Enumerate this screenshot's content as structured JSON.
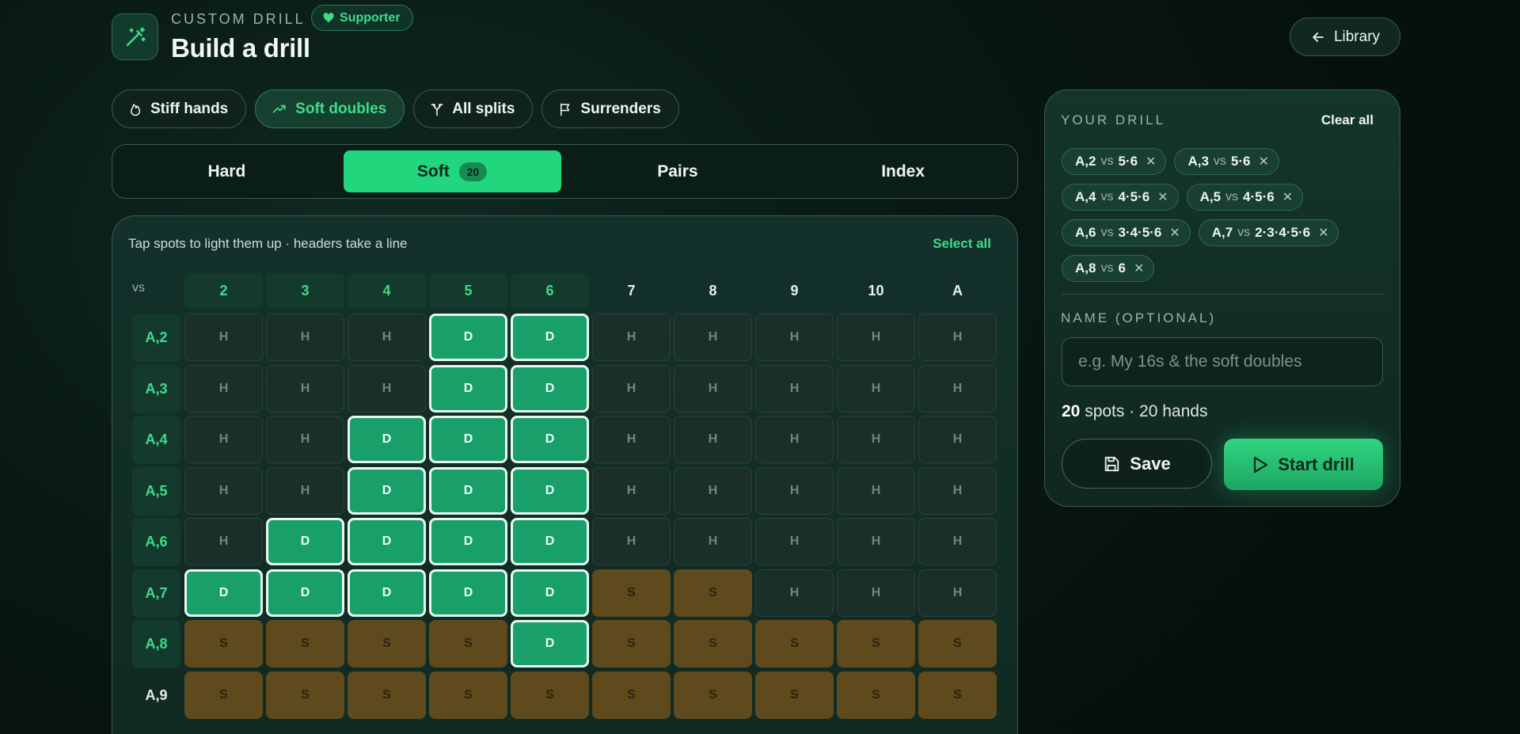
{
  "header": {
    "eyebrow": "CUSTOM DRILL",
    "badge": "Supporter",
    "title": "Build a drill",
    "library_label": "Library"
  },
  "presets": [
    {
      "label": "Stiff hands",
      "icon": "flame-icon",
      "active": false
    },
    {
      "label": "Soft doubles",
      "icon": "trending-up-icon",
      "active": true
    },
    {
      "label": "All splits",
      "icon": "split-icon",
      "active": false
    },
    {
      "label": "Surrenders",
      "icon": "flag-icon",
      "active": false
    }
  ],
  "tabs": [
    {
      "label": "Hard",
      "active": false
    },
    {
      "label": "Soft",
      "active": true,
      "count": "20"
    },
    {
      "label": "Pairs",
      "active": false
    },
    {
      "label": "Index",
      "active": false
    }
  ],
  "grid": {
    "hint": "Tap spots to light them up · headers take a line",
    "select_all": "Select all",
    "vs_label": "vs",
    "columns": [
      "2",
      "3",
      "4",
      "5",
      "6",
      "7",
      "8",
      "9",
      "10",
      "A"
    ],
    "highlighted_columns": [
      0,
      1,
      2,
      3,
      4
    ],
    "rows": [
      {
        "label": "A,2",
        "highlighted": true,
        "cells": [
          "H",
          "H",
          "H",
          "D",
          "D",
          "H",
          "H",
          "H",
          "H",
          "H"
        ],
        "selected": [
          3,
          4
        ]
      },
      {
        "label": "A,3",
        "highlighted": true,
        "cells": [
          "H",
          "H",
          "H",
          "D",
          "D",
          "H",
          "H",
          "H",
          "H",
          "H"
        ],
        "selected": [
          3,
          4
        ]
      },
      {
        "label": "A,4",
        "highlighted": true,
        "cells": [
          "H",
          "H",
          "D",
          "D",
          "D",
          "H",
          "H",
          "H",
          "H",
          "H"
        ],
        "selected": [
          2,
          3,
          4
        ]
      },
      {
        "label": "A,5",
        "highlighted": true,
        "cells": [
          "H",
          "H",
          "D",
          "D",
          "D",
          "H",
          "H",
          "H",
          "H",
          "H"
        ],
        "selected": [
          2,
          3,
          4
        ]
      },
      {
        "label": "A,6",
        "highlighted": true,
        "cells": [
          "H",
          "D",
          "D",
          "D",
          "D",
          "H",
          "H",
          "H",
          "H",
          "H"
        ],
        "selected": [
          1,
          2,
          3,
          4
        ]
      },
      {
        "label": "A,7",
        "highlighted": true,
        "cells": [
          "D",
          "D",
          "D",
          "D",
          "D",
          "S",
          "S",
          "H",
          "H",
          "H"
        ],
        "selected": [
          0,
          1,
          2,
          3,
          4
        ]
      },
      {
        "label": "A,8",
        "highlighted": true,
        "cells": [
          "S",
          "S",
          "S",
          "S",
          "D",
          "S",
          "S",
          "S",
          "S",
          "S"
        ],
        "selected": [
          4
        ]
      },
      {
        "label": "A,9",
        "highlighted": false,
        "cells": [
          "S",
          "S",
          "S",
          "S",
          "S",
          "S",
          "S",
          "S",
          "S",
          "S"
        ],
        "selected": []
      }
    ]
  },
  "drill": {
    "title": "YOUR DRILL",
    "clear_all": "Clear all",
    "vs_word": "vs",
    "chips": [
      {
        "hand": "A,2",
        "upcards": "5·6"
      },
      {
        "hand": "A,3",
        "upcards": "5·6"
      },
      {
        "hand": "A,4",
        "upcards": "4·5·6"
      },
      {
        "hand": "A,5",
        "upcards": "4·5·6"
      },
      {
        "hand": "A,6",
        "upcards": "3·4·5·6"
      },
      {
        "hand": "A,7",
        "upcards": "2·3·4·5·6"
      },
      {
        "hand": "A,8",
        "upcards": "6"
      }
    ],
    "name_label": "NAME (OPTIONAL)",
    "name_placeholder": "e.g. My 16s & the soft doubles",
    "name_value": "",
    "summary_count": "20",
    "summary_rest": " spots · 20 hands",
    "save_label": "Save",
    "start_label": "Start drill"
  },
  "colors": {
    "accent": "#22d67e",
    "double": "#19a06a",
    "stand": "#5e4a1c",
    "hit": "#1b2f2a"
  }
}
